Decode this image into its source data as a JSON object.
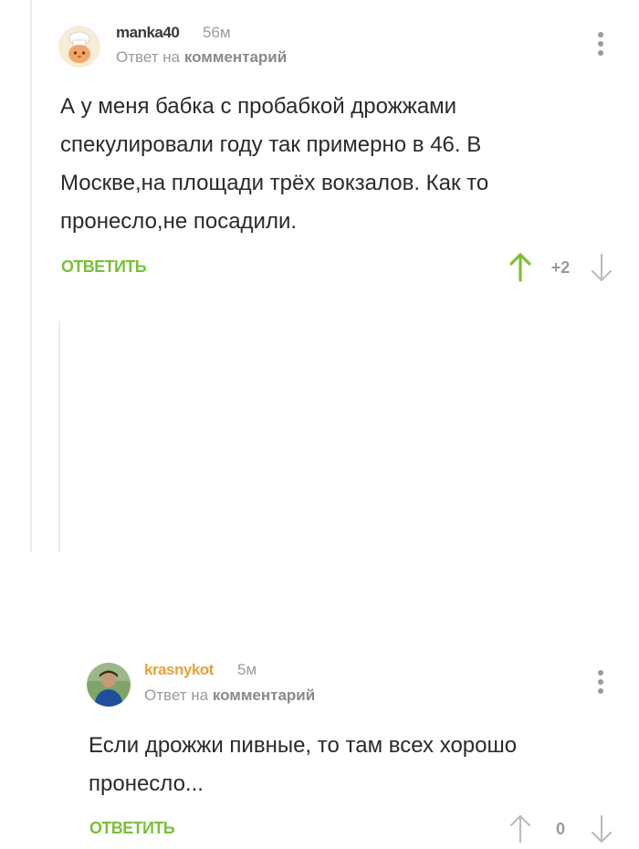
{
  "comments": [
    {
      "username": "manka40",
      "time": "56м",
      "reply_prefix": "Ответ на",
      "reply_target": "комментарий",
      "text": "А у меня бабка с пробабкой дрожжами спекулировали году так примерно в 46. В Москве,на площади трёх вокзалов. Как то пронесло,не посадили.",
      "reply_label": "ОТВЕТИТЬ",
      "score": "+2",
      "vote_state": "up",
      "colors": {
        "username": "#3a3a3a",
        "vote_up": "#7bbf3b"
      },
      "avatar_icon": "chef-cat-icon"
    },
    {
      "username": "krasnykot",
      "time": "5м",
      "reply_prefix": "Ответ на",
      "reply_target": "комментарий",
      "text": "Если дрожжи пивные, то там всех хорошо пронесло...",
      "reply_label": "ОТВЕТИТЬ",
      "score": "0",
      "vote_state": "none",
      "colors": {
        "username": "#e8a23a",
        "vote_up": "#bdbdbd"
      },
      "avatar_icon": "user-photo-icon"
    }
  ],
  "theme": {
    "accent": "#7bbf3b",
    "muted": "#9a9a9a"
  }
}
